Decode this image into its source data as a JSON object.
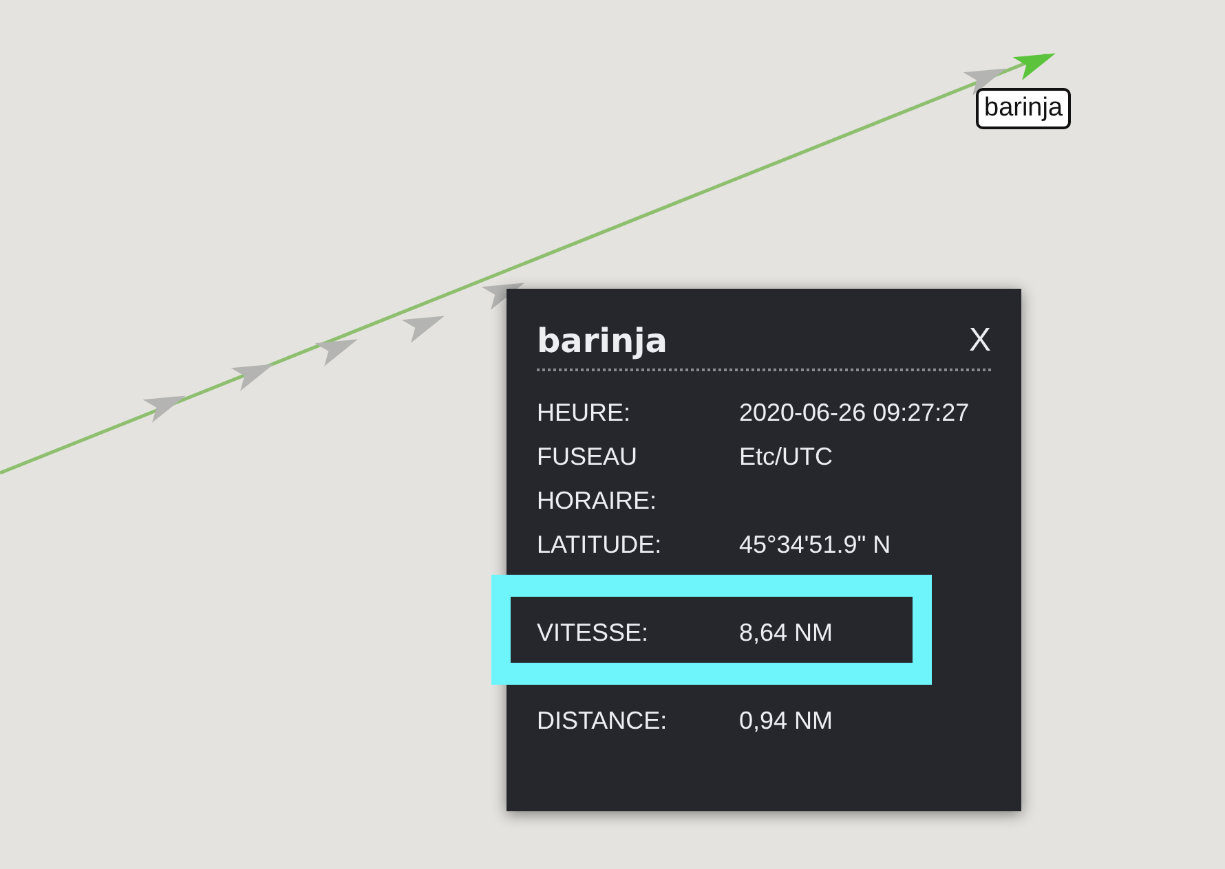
{
  "map": {
    "vessel_label": "barinja"
  },
  "popup": {
    "title": "barinja",
    "close": "X",
    "rows": [
      {
        "kind": "field",
        "label": "HEURE:",
        "value": "2020-06-26 09:27:27",
        "highlighted": false
      },
      {
        "kind": "field",
        "label": "FUSEAU HORAIRE:",
        "value": "Etc/UTC",
        "highlighted": false
      },
      {
        "kind": "field",
        "label": "LATITUDE:",
        "value": "45°34'51.9\" N",
        "highlighted": false
      },
      {
        "kind": "covered"
      },
      {
        "kind": "field",
        "label": "VITESSE:",
        "value": "8,64 NM",
        "highlighted": true
      },
      {
        "kind": "covered"
      },
      {
        "kind": "field",
        "label": "DISTANCE:",
        "value": "0,94 NM",
        "highlighted": false
      }
    ]
  }
}
